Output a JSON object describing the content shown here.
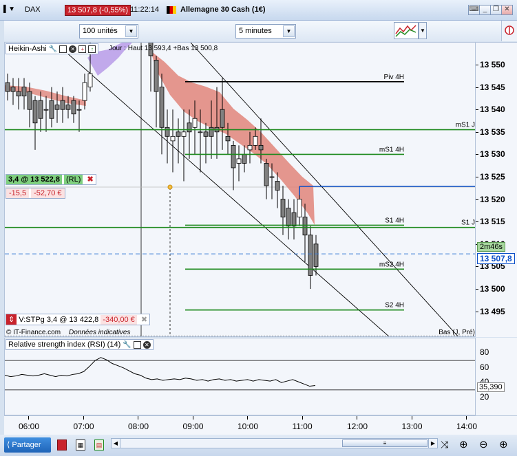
{
  "titlebar": {
    "instrument": "DAX",
    "price_badge": "13 507,8 (-0,55%)",
    "time": "11:22:14",
    "product": "Allemagne 30 Cash (1€)",
    "win_icons": [
      "keyboard-icon",
      "minimize-icon",
      "restore-icon",
      "close-icon"
    ]
  },
  "toolbar": {
    "quantity": "100 unités",
    "period": "5 minutes"
  },
  "chart": {
    "indicator_label": "Heikin-Ashi",
    "ohlc": "Jour : Haut 13 593,4 +Bas 13 500,8",
    "levels": {
      "piv4h": "Piv 4H",
      "ms1j": "mS1 J",
      "ms14h": "mS1 4H",
      "s14h": "S1 4H",
      "s1j": "S1 J",
      "ms24h": "mS2 4H",
      "s24h": "S2 4H",
      "basj": "Bas (J, Pré)"
    },
    "position": {
      "qty_price": "3,4 @ 13 522,8",
      "rl": "(RL)",
      "pts": "-15,5",
      "pl": "-52,70 €"
    },
    "stop_order": {
      "label": "V:STPg",
      "qty_price": "3,4 @ 13 422,8",
      "amount": "-340,00 €"
    },
    "footer": "© IT-Finance.com",
    "footer_note": "Données indicatives",
    "countdown": "2m46s",
    "last_price": "13 507,8",
    "price_ticks": [
      "13 550",
      "13 545",
      "13 540",
      "13 535",
      "13 530",
      "13 525",
      "13 520",
      "13 515",
      "13 510",
      "13 505",
      "13 500",
      "13 495"
    ],
    "rsi_top": "100"
  },
  "rsi": {
    "label": "Relative strength index (RSI) (14)",
    "value": "35,390",
    "ticks": [
      "80",
      "60",
      "40",
      "20"
    ]
  },
  "time_axis": [
    "06:00",
    "07:00",
    "08:00",
    "09:00",
    "10:00",
    "11:00",
    "12:00",
    "13:00",
    "14:00"
  ],
  "bottom": {
    "share": "Partager"
  },
  "colors": {
    "down": "#c8232c",
    "kijun_fill": "#e0857a",
    "up_fill": "#b79be8",
    "support": "#1e8a1e",
    "last_line": "#0a4fc8"
  },
  "chart_data": {
    "type": "candlestick",
    "ylim": [
      13492,
      13556
    ],
    "x": [
      "06:00",
      "07:00",
      "08:00",
      "09:00",
      "10:00",
      "11:00",
      "12:00",
      "13:00",
      "14:00"
    ],
    "levels": [
      {
        "name": "Piv 4H",
        "value": 13546.2
      },
      {
        "name": "mS1 J",
        "value": 13535.5
      },
      {
        "name": "mS1 4H",
        "value": 13530.0
      },
      {
        "name": "S1 4H",
        "value": 13514.2
      },
      {
        "name": "S1 J",
        "value": 13513.7
      },
      {
        "name": "mS2 4H",
        "value": 13504.4
      },
      {
        "name": "S2 4H",
        "value": 13495.3
      }
    ],
    "last": 13507.8,
    "rsi_last": 35.39
  }
}
